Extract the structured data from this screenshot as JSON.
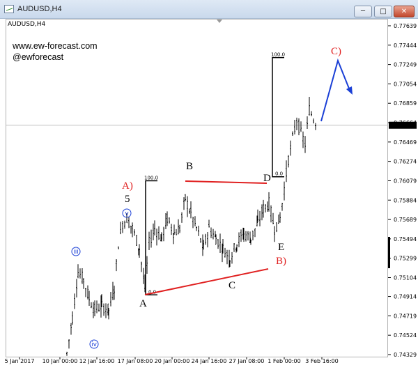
{
  "window": {
    "title": "AUDUSD,H4",
    "min_label": "─",
    "max_label": "□",
    "close_label": "✕"
  },
  "chart": {
    "symbol": "AUDUSD,H4",
    "site": "www.ew-forecast.com",
    "handle": "@ewforecast",
    "current_price": "0.76638",
    "bg_color": "#ffffff",
    "candle_color": "#000000",
    "annotation_red": "#e02020",
    "annotation_blue": "#1a3fd6"
  },
  "chart_data": {
    "type": "candlestick",
    "price_ticks": [
      "0.77639",
      "0.77444",
      "0.77249",
      "0.77054",
      "0.76859",
      "0.76664",
      "0.76469",
      "0.76274",
      "0.76079",
      "0.75884",
      "0.75689",
      "0.75494",
      "0.75299",
      "0.75104",
      "0.74914",
      "0.74719",
      "0.74524",
      "0.74329"
    ],
    "price_values": [
      0.77639,
      0.77444,
      0.77249,
      0.77054,
      0.76859,
      0.76664,
      0.76469,
      0.76274,
      0.76079,
      0.75884,
      0.75689,
      0.75494,
      0.75299,
      0.75104,
      0.74914,
      0.74719,
      0.74524,
      0.74329
    ],
    "date_ticks": [
      "5 Jan 2017",
      "10 Jan 00:00",
      "12 Jan 16:00",
      "17 Jan 08:00",
      "20 Jan 00:00",
      "24 Jan 16:00",
      "27 Jan 08:00",
      "1 Feb 00:00",
      "3 Feb 16:00"
    ],
    "ylim": [
      0.7426,
      0.7774
    ],
    "current_price": 0.76638,
    "fib_levels": [
      {
        "label": "100.0",
        "price": 0.76079
      },
      {
        "label": "0.0",
        "price": 0.7493
      },
      {
        "label": "100.0",
        "price": 0.77319
      },
      {
        "label": "0.0",
        "price": 0.76119
      }
    ],
    "wave_labels": {
      "A": "A",
      "B": "B",
      "C": "C",
      "D": "D",
      "E": "E",
      "A_paren": "A)",
      "B_paren": "B)",
      "C_paren": "C)",
      "five": "5",
      "iii": "iii",
      "iv": "iv",
      "v": "v"
    }
  }
}
